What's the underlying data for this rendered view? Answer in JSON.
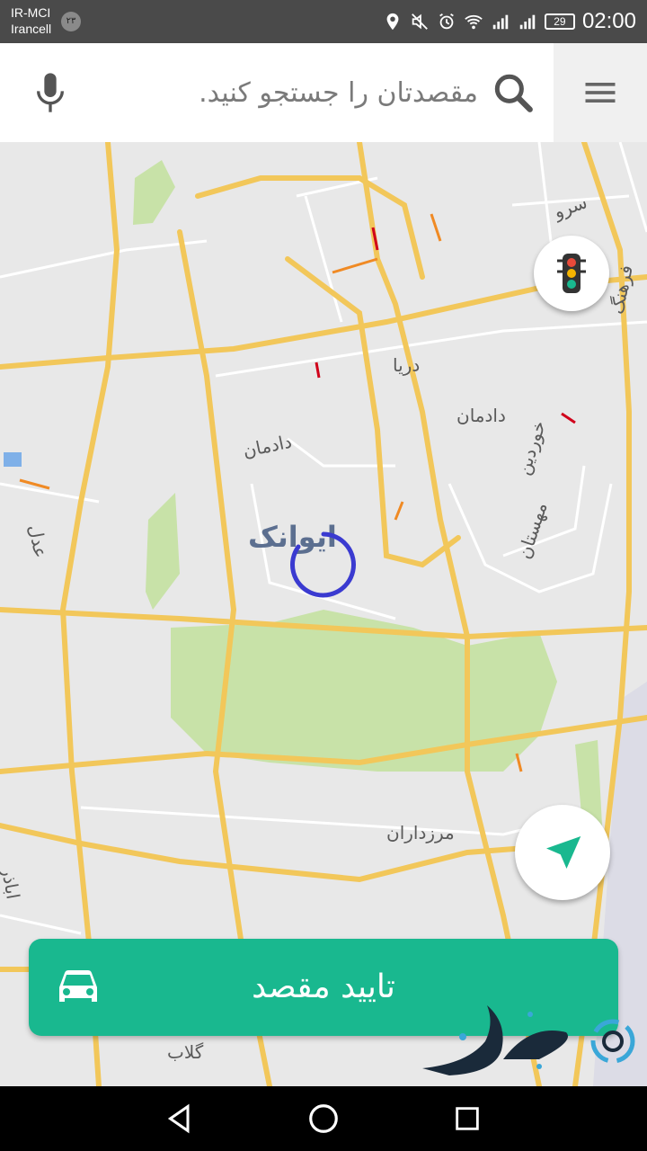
{
  "status_bar": {
    "carrier_line1": "IR-MCI",
    "carrier_line2": "Irancell",
    "sim_badge": "۲۳",
    "battery": "29",
    "time": "02:00",
    "icons": [
      "location-icon",
      "mute-icon",
      "alarm-icon",
      "wifi-icon",
      "signal-icon",
      "signal-icon",
      "battery-icon"
    ]
  },
  "search": {
    "placeholder": "مقصدتان را جستجو کنید."
  },
  "map": {
    "labels": {
      "darya": "دریا",
      "dadman_1": "دادمان",
      "dadman_2": "دادمان",
      "sarv": "سرو",
      "farhang": "فرهنگ",
      "khordin": "خوردین",
      "mahestan": "مهستان",
      "adl": "عدل",
      "marzdaran": "مرزداران",
      "golab": "گلاب",
      "abader": "اباذر",
      "ekbatan": "ایوانک"
    }
  },
  "confirm_button": {
    "label": "تایید مقصد"
  },
  "colors": {
    "accent": "#19b88f",
    "road_major": "#f2c75a",
    "park": "#c8e2a8",
    "map_bg": "#e8e8e8",
    "spinner": "#3a3ad0"
  }
}
